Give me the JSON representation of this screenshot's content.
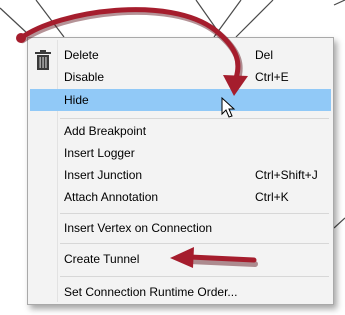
{
  "menu": {
    "items": [
      {
        "label": "Delete",
        "shortcut": "Del",
        "icon": "trash-icon"
      },
      {
        "label": "Disable",
        "shortcut": "Ctrl+E"
      },
      {
        "label": "Hide",
        "shortcut": "",
        "highlighted": true
      },
      {
        "label": "Add Breakpoint",
        "shortcut": ""
      },
      {
        "label": "Insert Logger",
        "shortcut": ""
      },
      {
        "label": "Insert Junction",
        "shortcut": "Ctrl+Shift+J"
      },
      {
        "label": "Attach Annotation",
        "shortcut": "Ctrl+K"
      },
      {
        "label": "Insert Vertex on Connection",
        "shortcut": ""
      },
      {
        "label": "Create Tunnel",
        "shortcut": ""
      },
      {
        "label": "Set Connection Runtime Order...",
        "shortcut": ""
      }
    ]
  },
  "colors": {
    "highlight": "#91c9f7",
    "annotation_arrow": "#a51d2d"
  },
  "icons": [
    "trash-icon",
    "mouse-cursor-icon",
    "curved-arrow-annotation",
    "straight-arrow-annotation"
  ]
}
